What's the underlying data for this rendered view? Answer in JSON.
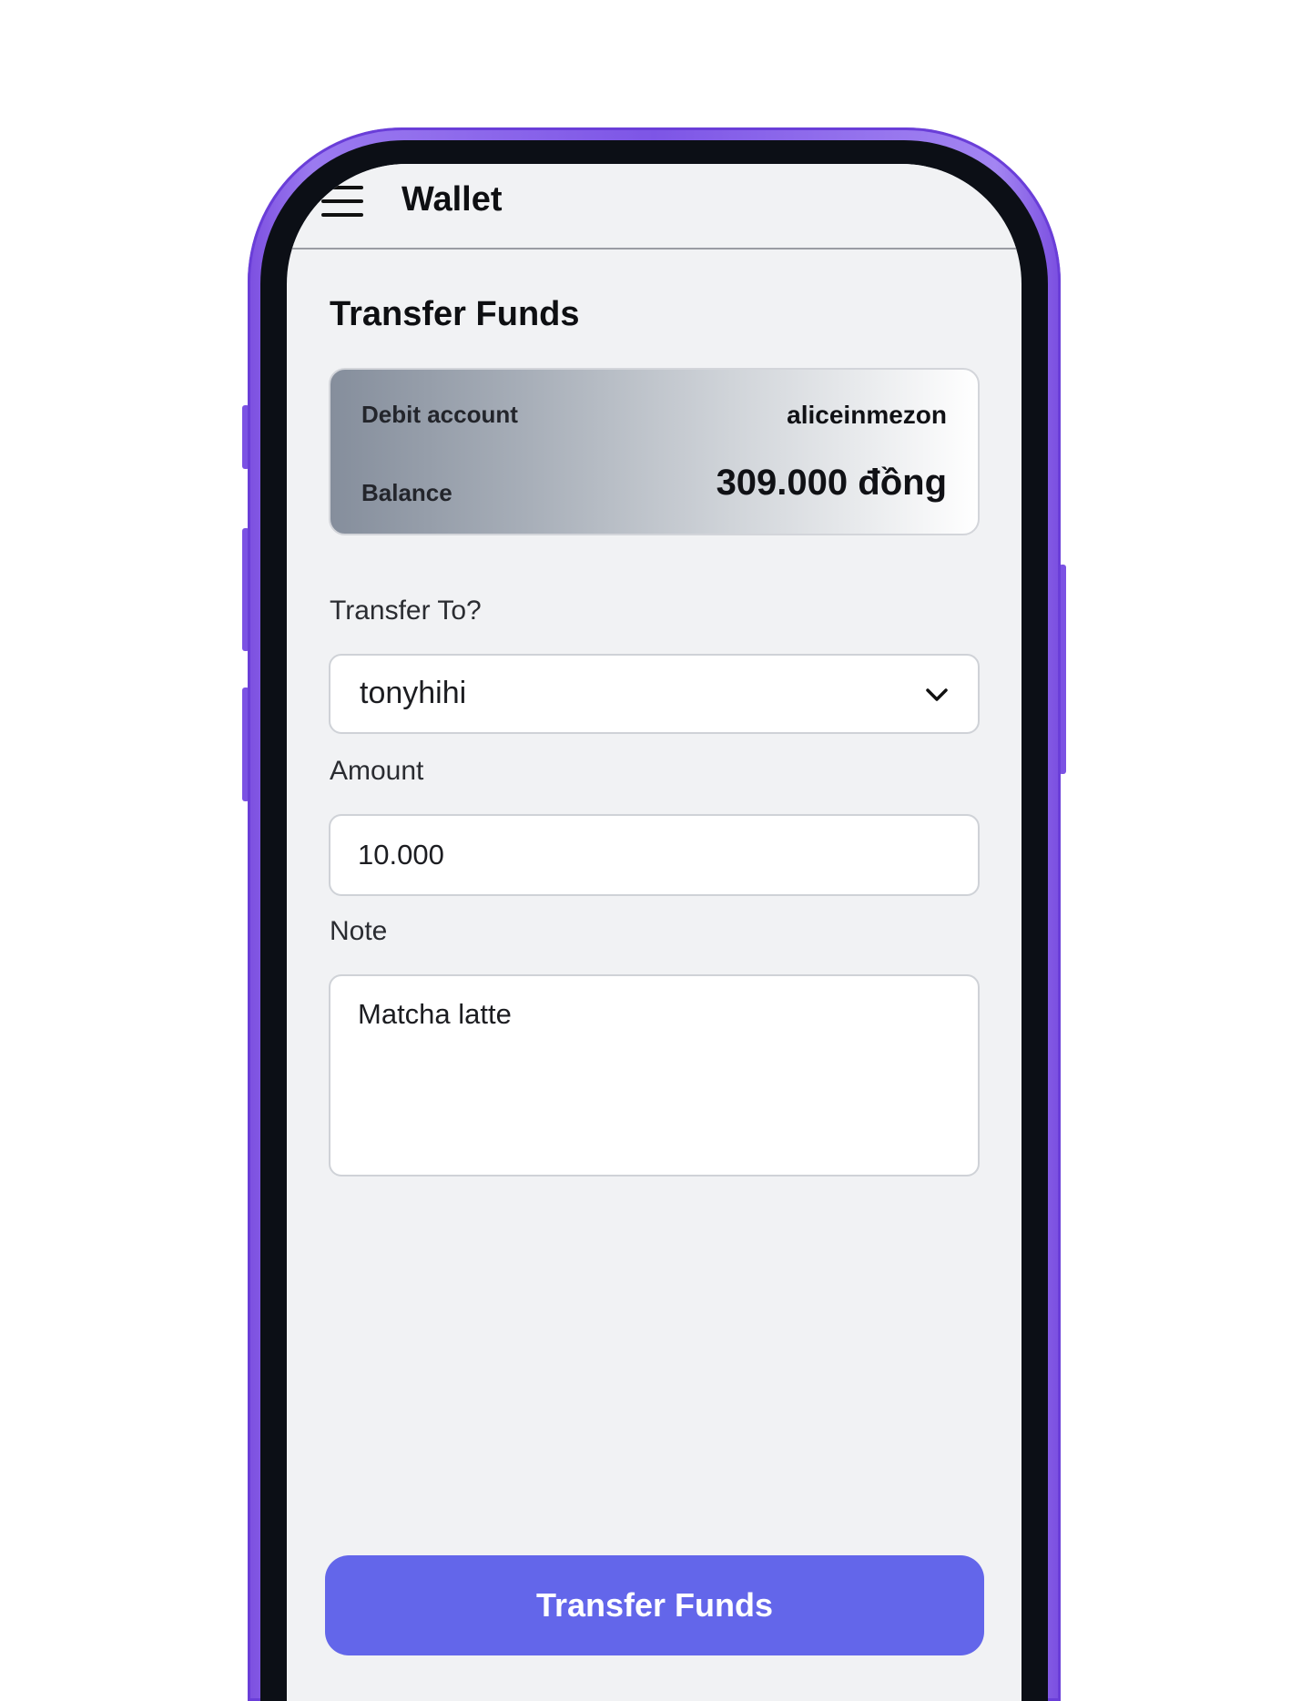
{
  "header": {
    "title": "Wallet",
    "menu_icon": "hamburger-menu-icon"
  },
  "page": {
    "heading": "Transfer Funds"
  },
  "account_card": {
    "debit_label": "Debit account",
    "username": "aliceinmezon",
    "balance_label": "Balance",
    "balance_value": "309.000 đồng"
  },
  "form": {
    "transfer_to_label": "Transfer To?",
    "transfer_to_value": "tonyhihi",
    "transfer_to_icon": "chevron-down-icon",
    "amount_label": "Amount",
    "amount_value": "10.000",
    "note_label": "Note",
    "note_value": "Matcha latte"
  },
  "actions": {
    "submit_label": "Transfer Funds"
  },
  "colors": {
    "accent": "#6366ea",
    "phone_frame": "#7c4fe0",
    "screen_bg": "#f1f2f4"
  }
}
